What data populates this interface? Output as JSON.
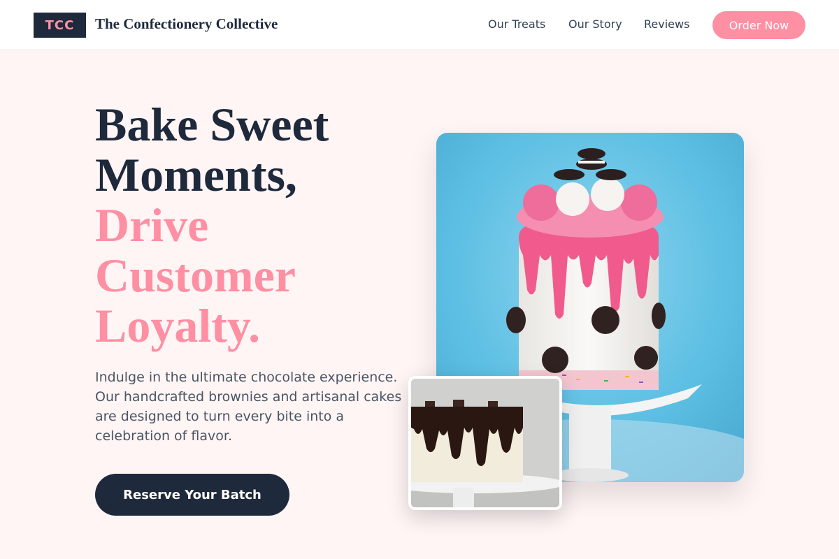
{
  "header": {
    "logo_text": "TCC",
    "brand_name": "The Confectionery Collective",
    "nav": [
      {
        "label": "Our Treats"
      },
      {
        "label": "Our Story"
      },
      {
        "label": "Reviews"
      }
    ],
    "order_button": "Order Now"
  },
  "hero": {
    "headline_line1": "Bake Sweet",
    "headline_line2": "Moments,",
    "headline_accent1": "Drive",
    "headline_accent2": "Customer",
    "headline_accent3": "Loyalty.",
    "description": "Indulge in the ultimate chocolate experience. Our handcrafted brownies and artisanal cakes are designed to turn every bite into a celebration of flavor.",
    "cta_button": "Reserve Your Batch"
  },
  "images": {
    "main_icon": "drip-cake-photo",
    "secondary_icon": "chocolate-cake-photo"
  },
  "colors": {
    "accent": "#ff8fa3",
    "dark": "#1e293b",
    "background": "#fff5f5"
  }
}
